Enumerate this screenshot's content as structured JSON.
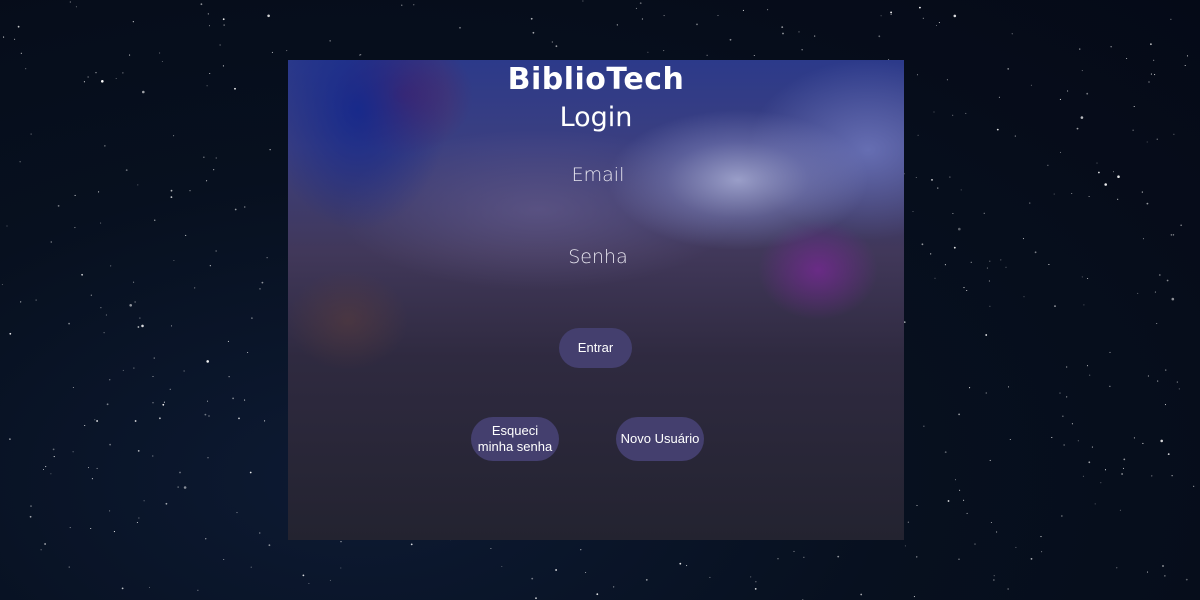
{
  "app": {
    "brand": "BiblioTech",
    "title": "Login"
  },
  "form": {
    "email_placeholder": "Email",
    "email_value": "",
    "password_placeholder": "Senha",
    "password_value": "",
    "login_label": "Entrar",
    "forgot_label": "Esqueci minha senha",
    "new_user_label": "Novo Usuário"
  },
  "colors": {
    "page_background": "#050a17",
    "button_background": "#443f6e",
    "text": "#ffffff"
  }
}
